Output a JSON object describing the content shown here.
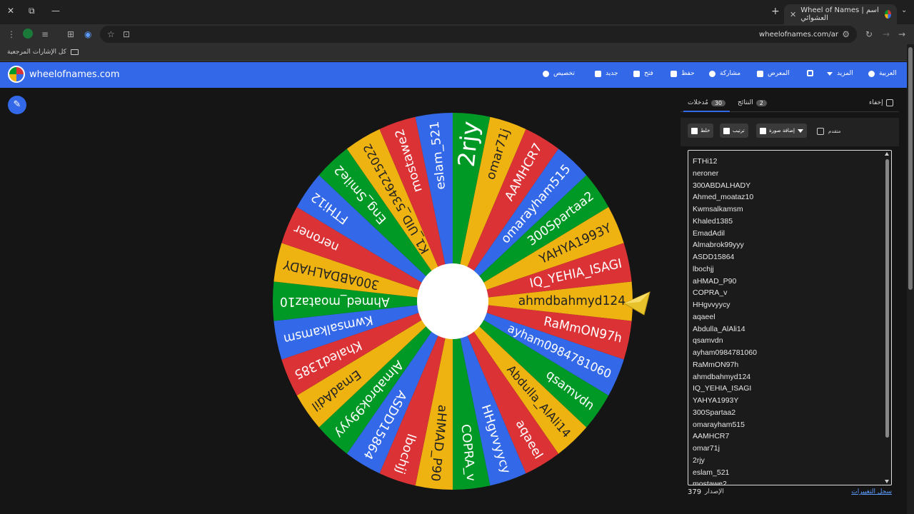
{
  "browser": {
    "tab_title": "Wheel of Names | اسم العشوائي",
    "url": "wheelofnames.com/ar",
    "bookmarks_label": "كل الإشارات المرجعية"
  },
  "header": {
    "site_name": "wheelofnames.com",
    "menu": {
      "customize": "تخصيص",
      "new": "جديد",
      "open": "فتح",
      "save": "حفظ",
      "share": "مشاركة",
      "gallery": "المعرض",
      "more": "المزيد",
      "language": "العربية"
    }
  },
  "panel": {
    "tab_entries": "مُدخلات",
    "entries_count": "30",
    "tab_results": "النتائج",
    "results_count": "2",
    "hide_label": "إخفاء",
    "shuffle_label": "خلط",
    "sort_label": "ترتيب",
    "add_image_label": "إضافة صورة",
    "advanced_label": "متقدم",
    "version_label": "الإصدار",
    "version_number": "379",
    "changelog_link": "سجل التغييرات"
  },
  "entries": [
    "FTHi12",
    "neroner",
    "300ABDALHADY",
    "Ahmed_moataz10",
    "Kwmsalkamsm",
    "Khaled1385",
    "EmadAdil",
    "Almabrok99yyy",
    "ASDD15864",
    "lbochjj",
    "aHMAD_P90",
    "COPRA_v",
    "HHgvvyycy",
    "aqaeel",
    "Abdulla_AlAli14",
    "qsamvdn",
    "ayham0984781060",
    "RaMmON97h",
    "ahmdbahmyd124",
    "IQ_YEHIA_ISAGI",
    "YAHYA1993Y",
    "300Spartaa2",
    "omarayham515",
    "AAMHCR7",
    "omar71j",
    "2rjy",
    "eslam_521",
    "mostawe2"
  ],
  "wheel": {
    "colors": [
      "#eeb211",
      "#db3236",
      "#3369e8",
      "#009925"
    ],
    "segments": [
      "ahmdbahmyd124",
      "RaMmON97h",
      "ayham0984781060",
      "qsamvdn",
      "Abdulla_AlAli14",
      "aqaeel",
      "HHgvvyycy",
      "COPRA_v",
      "aHMAD_P90",
      "lbochjj",
      "ASDD15864",
      "Almabrok99yyy",
      "EmadAdil",
      "Khaled1385",
      "Kwmsalkamsm",
      "Ahmed_moataz10",
      "300ABDALHADY",
      "neroner",
      "FTHi12",
      "Eng_Smile2",
      "K1_UID_5346215022",
      "mostawe2",
      "eslam_521",
      "2rjy",
      "omar71j",
      "AAMHCR7",
      "omarayham515",
      "300Spartaa2",
      "YAHYA1993Y",
      "IQ_YEHIA_ISAGI"
    ]
  }
}
